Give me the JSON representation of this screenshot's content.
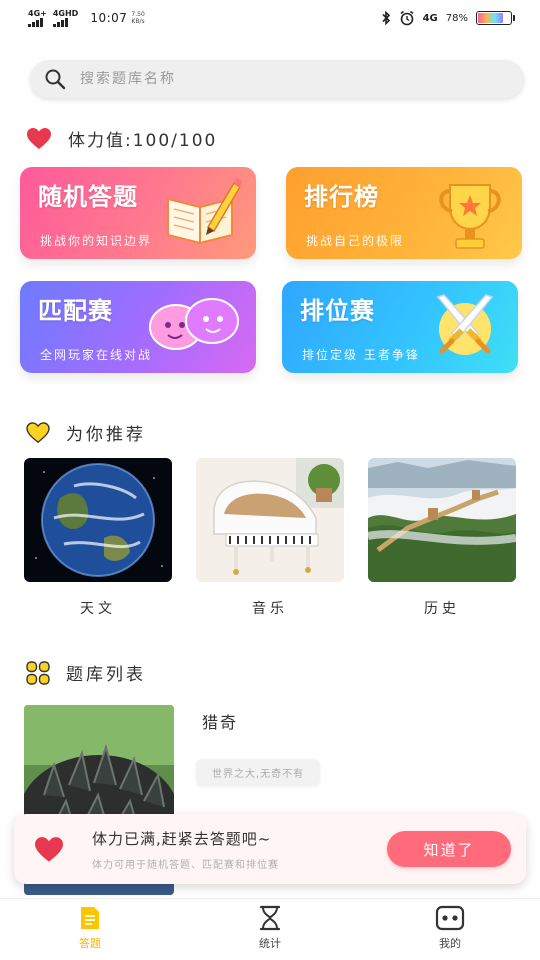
{
  "status_bar": {
    "net1": "4G+",
    "net2": "4GHD",
    "time": "10:07",
    "speed_value": "7.50",
    "speed_unit": "KB/s",
    "net3": "4G",
    "battery": "78%",
    "battery_level": 0.78
  },
  "search": {
    "placeholder": "搜索题库名称"
  },
  "stamina": {
    "label": "体力值:100/100"
  },
  "cards": [
    {
      "title": "随机答题",
      "subtitle": "挑战你的知识边界"
    },
    {
      "title": "排行榜",
      "subtitle": "挑战自己的极限"
    },
    {
      "title": "匹配赛",
      "subtitle": "全网玩家在线对战"
    },
    {
      "title": "排位赛",
      "subtitle": "排位定级 王者争锋"
    }
  ],
  "recommend": {
    "title": "为你推荐",
    "items": [
      {
        "name": "天文"
      },
      {
        "name": "音乐"
      },
      {
        "name": "历史"
      }
    ]
  },
  "bank": {
    "title": "题库列表",
    "items": [
      {
        "name": "猎奇",
        "tag": "世界之大,无奇不有"
      }
    ]
  },
  "toast": {
    "title": "体力已满,赶紧去答题吧~",
    "subtitle": "体力可用于随机答题、匹配赛和排位赛",
    "button": "知道了"
  },
  "tabbar": {
    "items": [
      {
        "label": "答题",
        "active": true
      },
      {
        "label": "统计",
        "active": false
      },
      {
        "label": "我的",
        "active": false
      }
    ]
  },
  "colors": {
    "accent": "#ffc400",
    "heart": "#e8384f",
    "toast_button": "#ff6b7a"
  }
}
